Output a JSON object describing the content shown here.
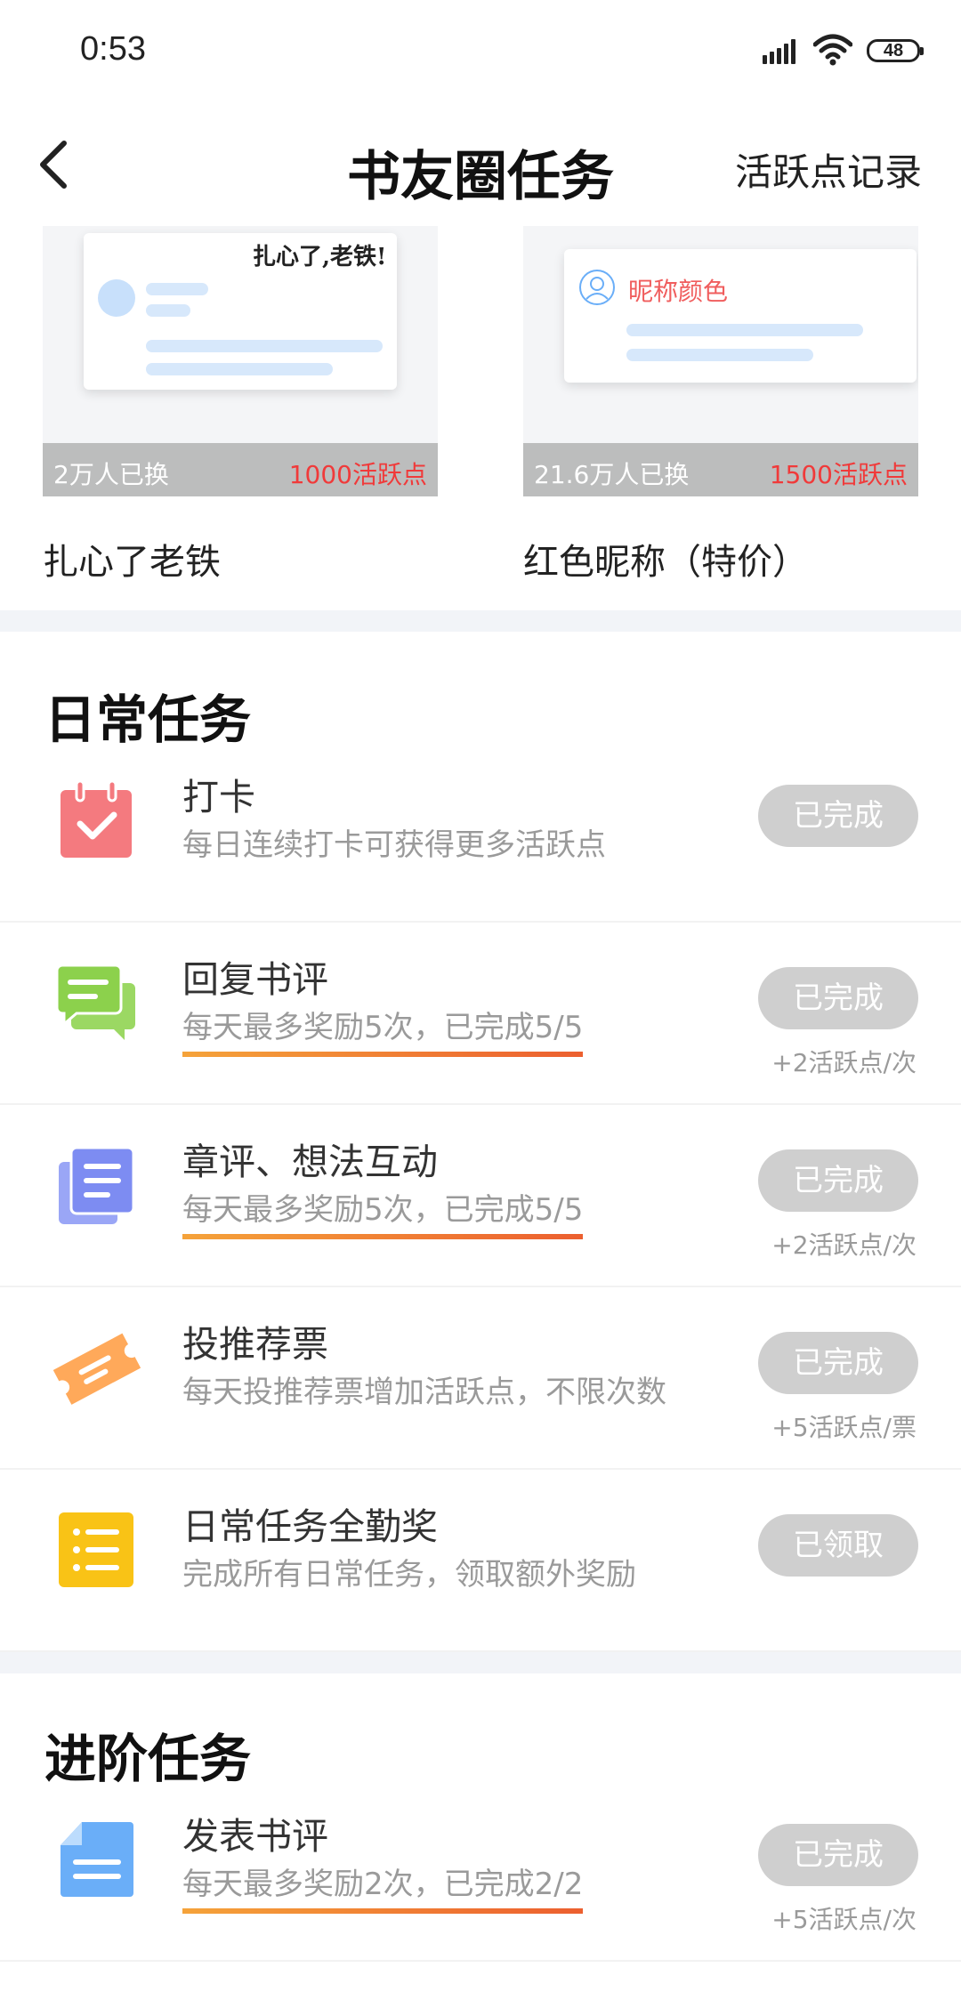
{
  "status_bar": {
    "time": "0:53",
    "battery": "48"
  },
  "nav": {
    "title": "书友圈任务",
    "right_link": "活跃点记录"
  },
  "reward_cards": [
    {
      "preview_text": "扎心了,老铁!",
      "count": "2万人已换",
      "price": "1000活跃点",
      "name": "扎心了老铁"
    },
    {
      "preview_text": "昵称颜色",
      "count": "21.6万人已换",
      "price": "1500活跃点",
      "name": "红色昵称（特价）"
    }
  ],
  "sections": {
    "daily": {
      "title": "日常任务",
      "tasks": [
        {
          "icon": "calendar-check-icon",
          "title": "打卡",
          "desc": "每日连续打卡可获得更多活跃点",
          "button": "已完成",
          "bonus": ""
        },
        {
          "icon": "chat-bubbles-icon",
          "title": "回复书评",
          "desc": "每天最多奖励5次，已完成5/5",
          "progress": 1.0,
          "button": "已完成",
          "bonus": "+2活跃点/次"
        },
        {
          "icon": "stacked-docs-icon",
          "title": "章评、想法互动",
          "desc": "每天最多奖励5次，已完成5/5",
          "progress": 1.0,
          "button": "已完成",
          "bonus": "+2活跃点/次"
        },
        {
          "icon": "ticket-icon",
          "title": "投推荐票",
          "desc": "每天投推荐票增加活跃点，不限次数",
          "button": "已完成",
          "bonus": "+5活跃点/票"
        },
        {
          "icon": "list-icon",
          "title": "日常任务全勤奖",
          "desc": "完成所有日常任务，领取额外奖励",
          "button": "已领取",
          "bonus": ""
        }
      ]
    },
    "advanced": {
      "title": "进阶任务",
      "tasks": [
        {
          "icon": "document-icon",
          "title": "发表书评",
          "desc": "每天最多奖励2次，已完成2/2",
          "progress": 1.0,
          "button": "已完成",
          "bonus": "+5活跃点/次"
        }
      ]
    }
  },
  "colors": {
    "button_disabled": "#cfcfcf",
    "price_red": "#f03a3a",
    "progress_start": "#f5a33a",
    "progress_end": "#ec5f2f",
    "icon_pink": "#f47a7f",
    "icon_green": "#8cd14c",
    "icon_purple": "#7d8cf2",
    "icon_orange": "#ffa95a",
    "icon_yellow": "#f9c316",
    "icon_blue": "#6aaef8"
  }
}
